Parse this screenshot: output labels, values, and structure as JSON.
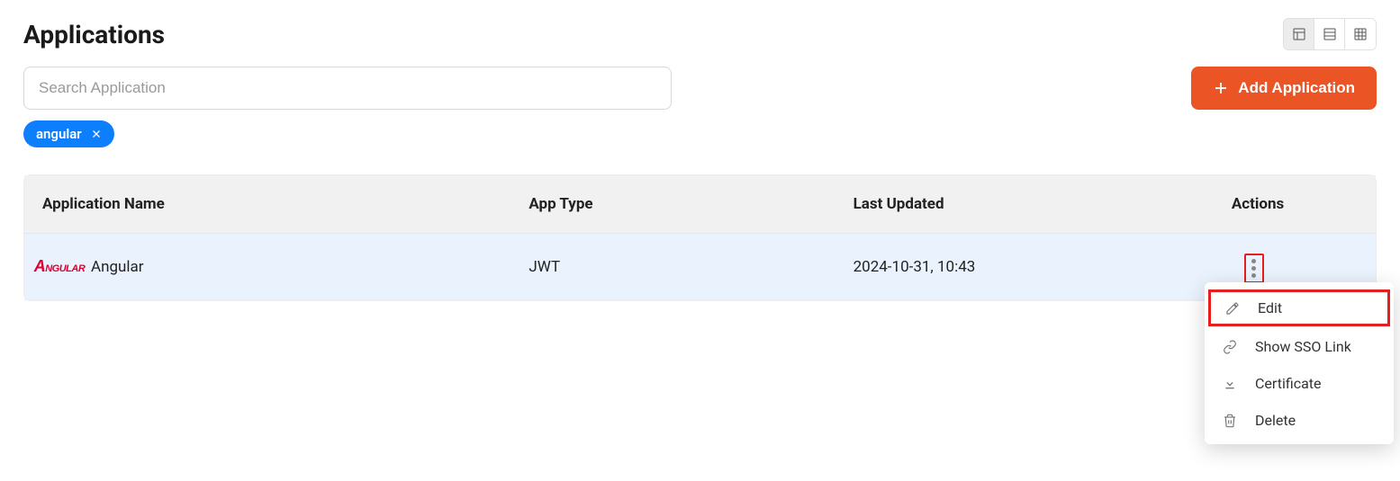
{
  "page": {
    "title": "Applications"
  },
  "search": {
    "placeholder": "Search Application",
    "value": ""
  },
  "filters": [
    {
      "label": "angular"
    }
  ],
  "actions": {
    "add_label": "Add Application"
  },
  "table": {
    "headers": {
      "name": "Application Name",
      "type": "App Type",
      "updated": "Last Updated",
      "actions": "Actions"
    },
    "rows": [
      {
        "name": "Angular",
        "logo": "angular",
        "type": "JWT",
        "updated": "2024-10-31, 10:43"
      }
    ]
  },
  "row_menu": {
    "items": [
      {
        "icon": "edit",
        "label": "Edit",
        "highlight": true
      },
      {
        "icon": "link",
        "label": "Show SSO Link"
      },
      {
        "icon": "download",
        "label": "Certificate"
      },
      {
        "icon": "trash",
        "label": "Delete"
      }
    ]
  }
}
